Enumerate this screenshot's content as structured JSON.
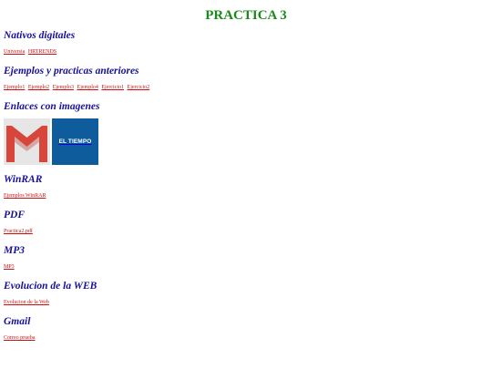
{
  "title": "PRACTICA 3",
  "sections": [
    {
      "heading": "Nativos digitales",
      "links": [
        "Universia",
        "HRTRENDS"
      ]
    },
    {
      "heading": "Ejemplos y practicas anteriores",
      "links": [
        "Ejemplo1",
        "Ejemplo2",
        "Ejemplo3",
        "Ejemplo4",
        "Ejercicio1",
        "Ejercicio2"
      ]
    },
    {
      "heading": "Enlaces con imagenes",
      "images": [
        {
          "name": "gmail-logo",
          "caption": ""
        },
        {
          "name": "el-tiempo-logo",
          "text": "EL TIEMPO"
        }
      ]
    },
    {
      "heading": "WinRAR",
      "links": [
        "Ejemplos WinRAR"
      ]
    },
    {
      "heading": "PDF",
      "links": [
        "Practica2.pdf"
      ]
    },
    {
      "heading": "MP3",
      "links": [
        "MP3"
      ]
    },
    {
      "heading": "Evolucion de la WEB",
      "links": [
        "Evolucion de la Web"
      ]
    },
    {
      "heading": "Gmail",
      "links": [
        "Correo prueba"
      ]
    }
  ],
  "colors": {
    "title": "#1b8a1b",
    "heading": "#16119b",
    "link": "#cc1111",
    "tiempo_bg": "#0f5c9c"
  }
}
